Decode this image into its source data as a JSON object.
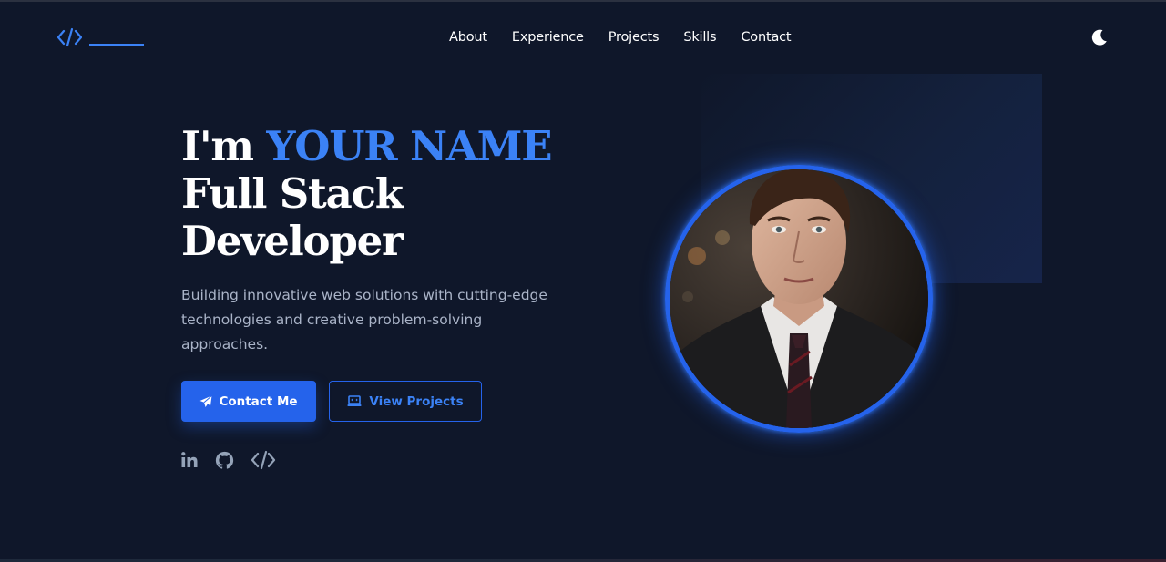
{
  "nav": {
    "items": [
      {
        "label": "About"
      },
      {
        "label": "Experience"
      },
      {
        "label": "Projects"
      },
      {
        "label": "Skills"
      },
      {
        "label": "Contact"
      }
    ]
  },
  "header": {
    "logo_icon": "code-icon",
    "theme_icon": "moon-icon"
  },
  "hero": {
    "greeting": "I'm ",
    "name": "YOUR NAME",
    "role_line1": "Full Stack",
    "role_line2": "Developer",
    "description": "Building innovative web solutions with cutting-edge technologies and creative problem-solving approaches.",
    "primary_button": "Contact Me",
    "primary_icon": "paper-plane-icon",
    "secondary_button": "View Projects",
    "secondary_icon": "laptop-icon"
  },
  "socials": [
    {
      "icon": "linkedin-icon"
    },
    {
      "icon": "github-icon"
    },
    {
      "icon": "code-icon"
    }
  ],
  "colors": {
    "background": "#0f172a",
    "accent": "#3b82f6",
    "button": "#2563eb",
    "muted_text": "#aab4c8"
  }
}
